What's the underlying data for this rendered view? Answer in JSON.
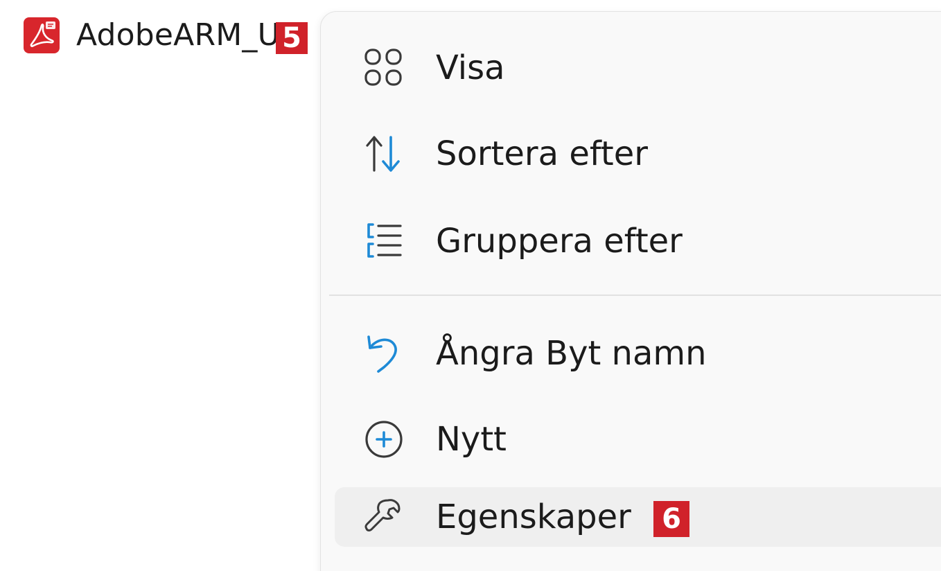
{
  "file": {
    "name": "AdobeARM_U",
    "icon": "pdf-icon",
    "badge": "5"
  },
  "menu": {
    "items": [
      {
        "label": "Visa",
        "icon": "grid-view-icon"
      },
      {
        "label": "Sortera efter",
        "icon": "sort-arrows-icon"
      },
      {
        "label": "Gruppera efter",
        "icon": "group-list-icon"
      },
      {
        "label": "Ångra Byt namn",
        "icon": "undo-icon"
      },
      {
        "label": "Nytt",
        "icon": "add-circle-icon"
      },
      {
        "label": "Egenskaper",
        "icon": "wrench-icon",
        "badge": "6"
      }
    ]
  },
  "colors": {
    "accent_blue": "#1e8ad6",
    "badge_red": "#d0222a",
    "pdf_red": "#d8262c",
    "menu_bg": "#f9f9f9",
    "hover_bg": "#efefef"
  }
}
